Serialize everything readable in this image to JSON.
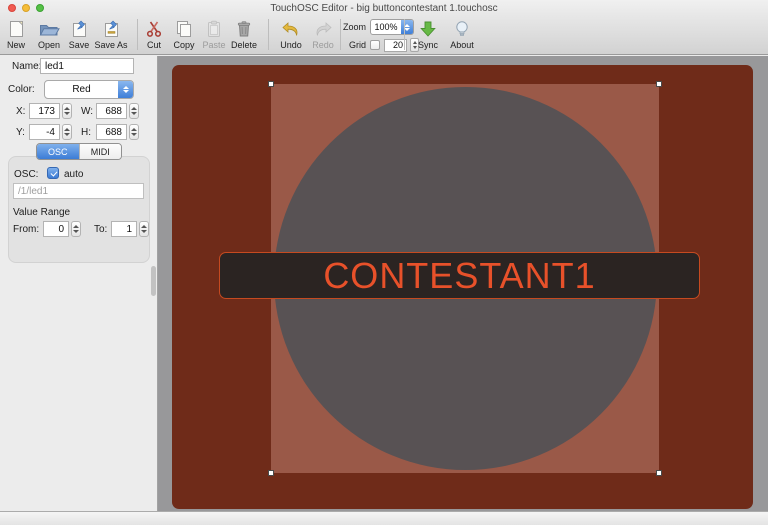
{
  "window": {
    "title": "TouchOSC Editor - big buttoncontestant 1.touchosc"
  },
  "toolbar": {
    "buttons": [
      {
        "label": "New",
        "icon": "new-document-icon",
        "enabled": true
      },
      {
        "label": "Open",
        "icon": "open-folder-icon",
        "enabled": true
      },
      {
        "label": "Save",
        "icon": "save-icon",
        "enabled": true
      },
      {
        "label": "Save As",
        "icon": "save-as-icon",
        "enabled": true
      },
      {
        "label": "Cut",
        "icon": "scissors-icon",
        "enabled": true
      },
      {
        "label": "Copy",
        "icon": "copy-pages-icon",
        "enabled": true
      },
      {
        "label": "Paste",
        "icon": "paste-clipboard-icon",
        "enabled": false
      },
      {
        "label": "Delete",
        "icon": "trash-icon",
        "enabled": true
      },
      {
        "label": "Undo",
        "icon": "undo-arrow-icon",
        "enabled": true
      },
      {
        "label": "Redo",
        "icon": "redo-arrow-icon",
        "enabled": false
      },
      {
        "label": "Sync",
        "icon": "sync-down-arrow-icon",
        "enabled": true
      },
      {
        "label": "About",
        "icon": "lightbulb-icon",
        "enabled": true
      }
    ],
    "zoom": {
      "label": "Zoom",
      "value": "100%"
    },
    "grid": {
      "label": "Grid",
      "value": "20",
      "checked": false
    }
  },
  "inspector": {
    "name": {
      "label": "Name:",
      "value": "led1"
    },
    "color": {
      "label": "Color:",
      "value": "Red"
    },
    "x": {
      "label": "X:",
      "value": "173"
    },
    "y": {
      "label": "Y:",
      "value": "-4"
    },
    "w": {
      "label": "W:",
      "value": "688"
    },
    "h": {
      "label": "H:",
      "value": "688"
    },
    "tabs": {
      "osc": "OSC",
      "midi": "MIDI",
      "selected": "OSC"
    },
    "osc": {
      "label": "OSC:",
      "auto_label": "auto",
      "auto_checked": true,
      "address": "/1/led1"
    },
    "value_range": {
      "label": "Value Range",
      "from_label": "From:",
      "from_value": "0",
      "to_label": "To:",
      "to_value": "1"
    }
  },
  "canvas": {
    "label_text": "CONTESTANT1",
    "colors": {
      "canvas_background": "#98989A",
      "page_red": "#6F2B19",
      "selection_red": "#9A5948",
      "circle_gray": "#585254",
      "banner_background": "#2B2422",
      "banner_text_orange": "#E8512A",
      "accent_blue": "#3C7CD6"
    }
  }
}
